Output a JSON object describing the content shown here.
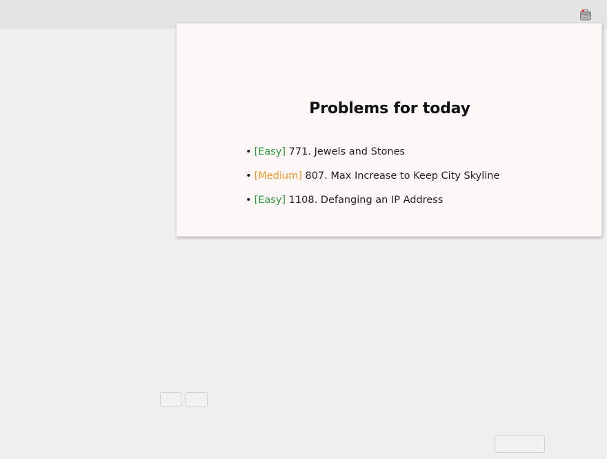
{
  "topbar": {
    "tray_icon": "toolbox-icon"
  },
  "popup": {
    "title": "Problems for today",
    "problems": [
      {
        "bullet": "•",
        "difficulty": "[Easy]",
        "level": "easy",
        "text": "771. Jewels and Stones"
      },
      {
        "bullet": "•",
        "difficulty": "[Medium]",
        "level": "medium",
        "text": "807. Max Increase to Keep City Skyline"
      },
      {
        "bullet": "•",
        "difficulty": "[Easy]",
        "level": "easy",
        "text": "1108. Defanging an IP Address"
      }
    ]
  },
  "colors": {
    "easy": "#2f9a38",
    "medium": "#f3982a",
    "popup_bg": "#fdf8f7",
    "page_bg": "#efefef"
  }
}
